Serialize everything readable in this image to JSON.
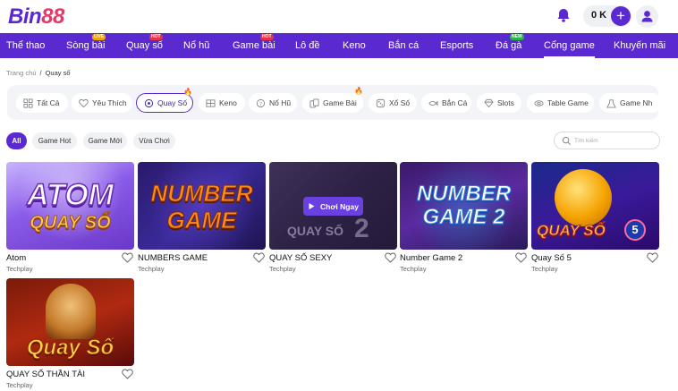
{
  "brand": {
    "logo_text_b": "Bin",
    "logo_text_n": "88"
  },
  "header": {
    "balance": "0 K",
    "plus_symbol": "+"
  },
  "nav": {
    "items": [
      {
        "label": "Thể thao"
      },
      {
        "label": "Sòng bài",
        "badge": "LIVE"
      },
      {
        "label": "Quay số",
        "badge": "HOT"
      },
      {
        "label": "Nổ hũ"
      },
      {
        "label": "Game bài",
        "badge": "HOT"
      },
      {
        "label": "Lô đề"
      },
      {
        "label": "Keno"
      },
      {
        "label": "Bắn cá"
      },
      {
        "label": "Esports"
      },
      {
        "label": "Đá gà",
        "badge": "NEW"
      },
      {
        "label": "Cổng game"
      },
      {
        "label": "Khuyến mãi"
      }
    ]
  },
  "breadcrumb": {
    "home": "Trang chủ",
    "separator": "/",
    "current": "Quay số"
  },
  "categories": [
    {
      "label": "Tất Cả",
      "icon": "grid-icon"
    },
    {
      "label": "Yêu Thích",
      "icon": "heart-icon"
    },
    {
      "label": "Quay Số",
      "icon": "lottery-icon",
      "active": true
    },
    {
      "label": "Keno",
      "icon": "keno-icon"
    },
    {
      "label": "Nổ Hũ",
      "icon": "jackpot-icon"
    },
    {
      "label": "Game Bài",
      "icon": "cards-icon"
    },
    {
      "label": "Xổ Số",
      "icon": "dice-icon"
    },
    {
      "label": "Bắn Cá",
      "icon": "fish-icon"
    },
    {
      "label": "Slots",
      "icon": "diamond-icon"
    },
    {
      "label": "Table Game",
      "icon": "table-icon"
    },
    {
      "label": "Game Nh",
      "icon": "gamepad-icon"
    }
  ],
  "filters": {
    "chips": [
      {
        "label": "All",
        "active": true
      },
      {
        "label": "Game Hot"
      },
      {
        "label": "Game Mới"
      },
      {
        "label": "Vừa Chơi"
      }
    ],
    "search_placeholder": "Tìm kiếm"
  },
  "games": [
    {
      "name": "Atom",
      "provider": "Techplay",
      "thumb_line1": "ATOM",
      "thumb_line2": "QUAY SỐ"
    },
    {
      "name": "NUMBERS GAME",
      "provider": "Techplay",
      "thumb_line1": "NUMBER",
      "thumb_line2": "GAME"
    },
    {
      "name": "QUAY SỐ SEXY",
      "provider": "Techplay",
      "thumb_line1": "QUAY SỐ",
      "thumb_line2": "2",
      "play_label": "Chơi Ngay"
    },
    {
      "name": "Number Game 2",
      "provider": "Techplay",
      "thumb_line1": "NUMBER",
      "thumb_line2": "GAME 2"
    },
    {
      "name": "Quay Số 5",
      "provider": "Techplay",
      "thumb_line1": "QUAY SỐ",
      "thumb_line2": "5"
    },
    {
      "name": "QUAY SỐ THẦN TÀI",
      "provider": "Techplay",
      "thumb_line1": "Quay Số"
    }
  ],
  "colors": {
    "primary": "#5a2ad0",
    "hot": "#e5334a",
    "live": "#f5a300",
    "new": "#29b34a"
  }
}
